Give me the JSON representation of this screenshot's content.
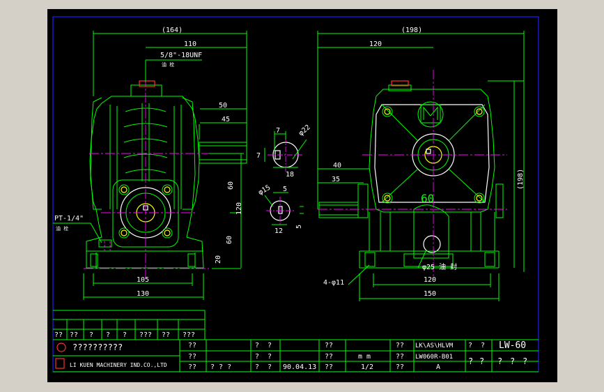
{
  "drawing": {
    "left_view": {
      "overall_width": "(164)",
      "width_110": "110",
      "thread": "5/8\"-18UNF",
      "plug_label": "油 栓",
      "shaft_50": "50",
      "shaft_45": "45",
      "h_60_top": "60",
      "h_120": "120",
      "h_60_bot": "60",
      "h_20": "20",
      "pt": "PT-1/4\"",
      "pt_label": "油 栓",
      "base_105": "105",
      "base_130": "130"
    },
    "key_sections": {
      "k7": "7",
      "dia22": "φ22",
      "k7v": "7",
      "k18": "18",
      "dia15": "φ15",
      "k5": "5",
      "k12": "12",
      "k5v": "5"
    },
    "right_view": {
      "overall_width": "(198)",
      "width_120": "120",
      "shaft_40": "40",
      "shaft_35": "35",
      "height_198": "(198)",
      "dia25": "φ25 油 封",
      "holes": "4-φ11",
      "base_120": "120",
      "base_150": "150",
      "mark_60": "60"
    }
  },
  "title_block": {
    "upper_row": [
      "??",
      "??",
      "?",
      "?",
      "?",
      "???",
      "??",
      "???"
    ],
    "company_cn": "??????????",
    "company_en": "LI KUEN MACHINERY IND.CO.,LTD",
    "r1": [
      "??",
      "?",
      "?",
      "??",
      "??",
      "LK\\AS\\HLVM",
      "?",
      "?"
    ],
    "r2": [
      "??",
      "?",
      "?",
      "??",
      "m m",
      "??",
      "LW060R-B01"
    ],
    "r3": [
      "??",
      "? ? ?",
      "?",
      "?",
      "90.04.13",
      "??",
      "1/2",
      "??",
      "A"
    ],
    "model": "LW-60",
    "big_q": [
      "?",
      "?",
      "?",
      "?",
      "?"
    ]
  },
  "colors": {
    "background": "#000000",
    "frame": "#1e1eff",
    "geometry": "#00ff00",
    "centerline": "#ff00ff",
    "text": "#ffffff"
  }
}
